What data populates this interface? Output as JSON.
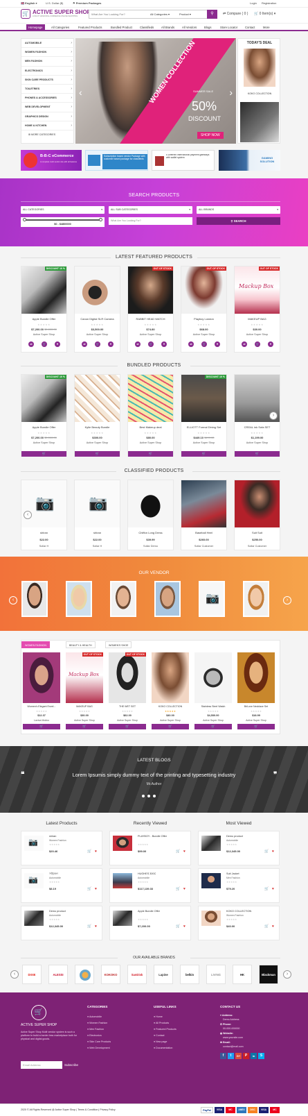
{
  "topbar": {
    "language": "English",
    "currency": "U.S. Dollar ($)",
    "premium": "Premium Packages",
    "login": "Login",
    "registration": "Registration"
  },
  "header": {
    "logo_mark": "🛒",
    "logo_title": "ACTIVE SUPER SHOP",
    "logo_tagline": "A MULTI VENDOR E-COMMERCE ONLINE SHOPPING",
    "search_placeholder": "What Are You Looking For?",
    "category_select": "All Categories",
    "type_select": "Product",
    "compare": "Compare ( 0 )",
    "cart": "0 Item(s)"
  },
  "nav": [
    "Homepage",
    "All Categories",
    "Featured Products",
    "Bundled Product",
    "Classifieds",
    "All Brands",
    "All Vendors",
    "Blogs",
    "Store Locator",
    "Contact",
    "More"
  ],
  "sidebar": {
    "items": [
      "AUTOMOBILE",
      "WOMEN FASHION",
      "MEN FASHION",
      "ELECTRONICS",
      "SKIN CARE PRODUCTS",
      "TOILETRIES",
      "PHONES & ACCESSORIES",
      "WEB DEVELOPMENT",
      "GRAPHICS DESIGN",
      "HOME & KITCHEN"
    ],
    "more": "MORE CATEGORIES"
  },
  "slider": {
    "banner": "WOMEN COLLECTION",
    "summer": "SUMMER SALE",
    "percent": "50%",
    "discount": "DISCOUNT",
    "cta": "SHOP NOW"
  },
  "deal": {
    "title": "TODAY'S DEAL",
    "item": "KOKO COLLECTION"
  },
  "promos": [
    {
      "title": "B-B-C eCommerce",
      "sub": "A complete multi vendor site with all features"
    },
    {
      "title": "Subscription based vendor",
      "sub": "Package with customer based package for classifieds"
    },
    {
      "title": "5 Different international payment gateways with wallet system",
      "sub": ""
    },
    {
      "title": "GAMING SOLUTION",
      "sub": ""
    }
  ],
  "search_section": {
    "title": "SEARCH PRODUCTS",
    "all_categories": "ALL CATEGORIES",
    "all_sub": "ALL SUB CATEGORIES",
    "all_brands": "ALL BRANDS",
    "range": "$0 - $4800000",
    "placeholder": "What Are You Looking For?",
    "button": "SEARCH"
  },
  "featured": {
    "title": "LATEST FEATURED PRODUCTS",
    "products": [
      {
        "name": "Apple Bundle Offer",
        "price": "$7,200.00",
        "old": "$9,000.00",
        "seller": "Active Super Shop",
        "badge": "DISCOUNT 10 %"
      },
      {
        "name": "Canon Digital SLR Camera",
        "price": "$3,500.00",
        "old": "",
        "seller": "Active Super Shop",
        "badge": ""
      },
      {
        "name": "RABBIT HEAD WATCH",
        "price": "$74.80",
        "old": "",
        "seller": "Active Super Shop",
        "badge": "OUT OF STOCK"
      },
      {
        "name": "Playboy London",
        "price": "$68.00",
        "old": "",
        "seller": "Active Super Shop",
        "badge": "OUT OF STOCK"
      },
      {
        "name": "MAKEUP BAG",
        "price": "$30.00",
        "old": "",
        "seller": "Active Super Shop",
        "badge": "OUT OF STOCK"
      }
    ]
  },
  "bundled": {
    "title": "BUNDLED PRODUCTS",
    "products": [
      {
        "name": "Apple Bundle Offer",
        "price": "$7,200.00",
        "old": "$9,000.00",
        "seller": "Active Super Shop",
        "badge": "DISCOUNT 10 %"
      },
      {
        "name": "Kylie Beauty Bundle",
        "price": "$300.00",
        "old": "",
        "seller": "Active Super Shop",
        "badge": ""
      },
      {
        "name": "Best Makeup deal",
        "price": "$80.00",
        "old": "",
        "seller": "Active Super Shop",
        "badge": ""
      },
      {
        "name": "ELLIOTT Formal Dining Set",
        "price": "$449.10",
        "old": "$499.00",
        "seller": "Active Super Shop",
        "badge": "DISCOUNT 10 %"
      },
      {
        "name": "CREAL ink Sofa SET",
        "price": "$1,199.00",
        "old": "",
        "seller": "Active Super Shop",
        "badge": ""
      }
    ]
  },
  "classified": {
    "title": "CLASSIFIED PRODUCTS",
    "products": [
      {
        "name": "shiran",
        "price": "$22.00",
        "seller": "Sollar H"
      },
      {
        "name": "shiran",
        "price": "$22.00",
        "seller": "Sollar H"
      },
      {
        "name": "Chiffon Long Dress",
        "price": "$39.99",
        "seller": "Sollar Demo"
      },
      {
        "name": "Baseball Heel",
        "price": "$260.00",
        "seller": "Sollar Customer"
      },
      {
        "name": "Suit Suit",
        "price": "$250.00",
        "seller": "Sollar Customer"
      }
    ]
  },
  "vendor": {
    "title": "OUR VENDOR"
  },
  "tabs": {
    "labels": [
      "WOMEN FASHION",
      "BEAUTY & HEALTH",
      "WOMEN'S SHOE"
    ],
    "products": [
      {
        "name": "Women's Elegant Envel...",
        "price": "$12.37",
        "seller": "Laviva Mokko",
        "badge": ""
      },
      {
        "name": "MAKEUP BAG",
        "price": "$30.00",
        "seller": "Active Super Shop",
        "badge": "OUT OF STOCK"
      },
      {
        "name": "THE WET SET",
        "price": "$62.00",
        "seller": "Active Super Shop",
        "badge": "OUT OF STOCK"
      },
      {
        "name": "KOKO COLLECTION",
        "price": "$40.00",
        "seller": "Active Super Shop",
        "badge": ""
      },
      {
        "name": "Stainless Steel Watch",
        "price": "$4,530.00",
        "seller": "Active Super Shop",
        "badge": ""
      },
      {
        "name": "BriLove Necklace Set",
        "price": "$18.99",
        "seller": "Active Super Shop",
        "badge": ""
      }
    ]
  },
  "blogs": {
    "title": "LATEST BLOGS",
    "quote": "Lorem Ipsumis simply dummy text of the printing and typesetting industry",
    "author": "Mr.Author"
  },
  "lists": {
    "latest": {
      "title": "Latest Products",
      "items": [
        {
          "name": "shiran",
          "cat": "Women Fashion",
          "price": "$20.46"
        },
        {
          "name": "সাইকেল",
          "cat": "Automobile",
          "price": "$8.19"
        },
        {
          "name": "Demo product",
          "cat": "Automobile",
          "price": "$12,345.00"
        }
      ]
    },
    "recent": {
      "title": "Recently Viewed",
      "items": [
        {
          "name": "PLAYBOY - Bundle Offer",
          "cat": "",
          "price": "$99.00"
        },
        {
          "name": "HUGHES 300C",
          "cat": "Automobile",
          "price": "$117,139.33"
        },
        {
          "name": "Apple Bundle Offer",
          "cat": "",
          "price": "$7,200.00"
        }
      ]
    },
    "most": {
      "title": "Most Viewed",
      "items": [
        {
          "name": "Demo product",
          "cat": "Automobile",
          "price": "$12,345.00"
        },
        {
          "name": "Suit Jacket",
          "cat": "Men Fashion",
          "price": "$79.20"
        },
        {
          "name": "KOKO COLLECTION",
          "cat": "Women Fashion",
          "price": "$40.00"
        }
      ]
    }
  },
  "brands": {
    "title": "OUR AVAILABLE BRANDS",
    "items": [
      "DIXIE",
      "ALESSI",
      "",
      "KOKOKO",
      "SanDisk",
      "Lapine",
      "belkin",
      "LIVING",
      "HK",
      "Blackman"
    ]
  },
  "footer": {
    "brand": "ACTIVE SUPER SHOP",
    "about": "Active Super Shop Multi vendor system is such a platform to build a border less marketplace both for physical and digital goods.",
    "newsletter_placeholder": "Email Address",
    "subscribe": "Subscribe",
    "categories_title": "CATEGORIES",
    "categories": [
      "Automobile",
      "Women Fashion",
      "Men Fashion",
      "Electronics",
      "Skin Care Products",
      "Web Development"
    ],
    "links_title": "USEFUL LINKS",
    "links": [
      "Home",
      "All Products",
      "Featured Products",
      "Contact",
      "New page",
      "Documentation"
    ],
    "contact_title": "CONTACT US",
    "address_label": "Address:",
    "address": "Demo Address",
    "phone_label": "Phone:",
    "phone": "00-000-000000",
    "website_label": "Website:",
    "website": "www.yoursite.com",
    "email_label": "Email:",
    "email": "contact@mail.com"
  },
  "copyright": "2020 © All Rights Reserved @ Active Super Shop | Terms & Condition | Privacy Policy",
  "payments": [
    "PayPal",
    "VISA",
    "MC",
    "AMEX",
    "DISC",
    "VISA",
    "MC"
  ],
  "colors": {
    "primary": "#8b2b8f",
    "pink": "#e44cb0",
    "footer": "#7e2275"
  }
}
